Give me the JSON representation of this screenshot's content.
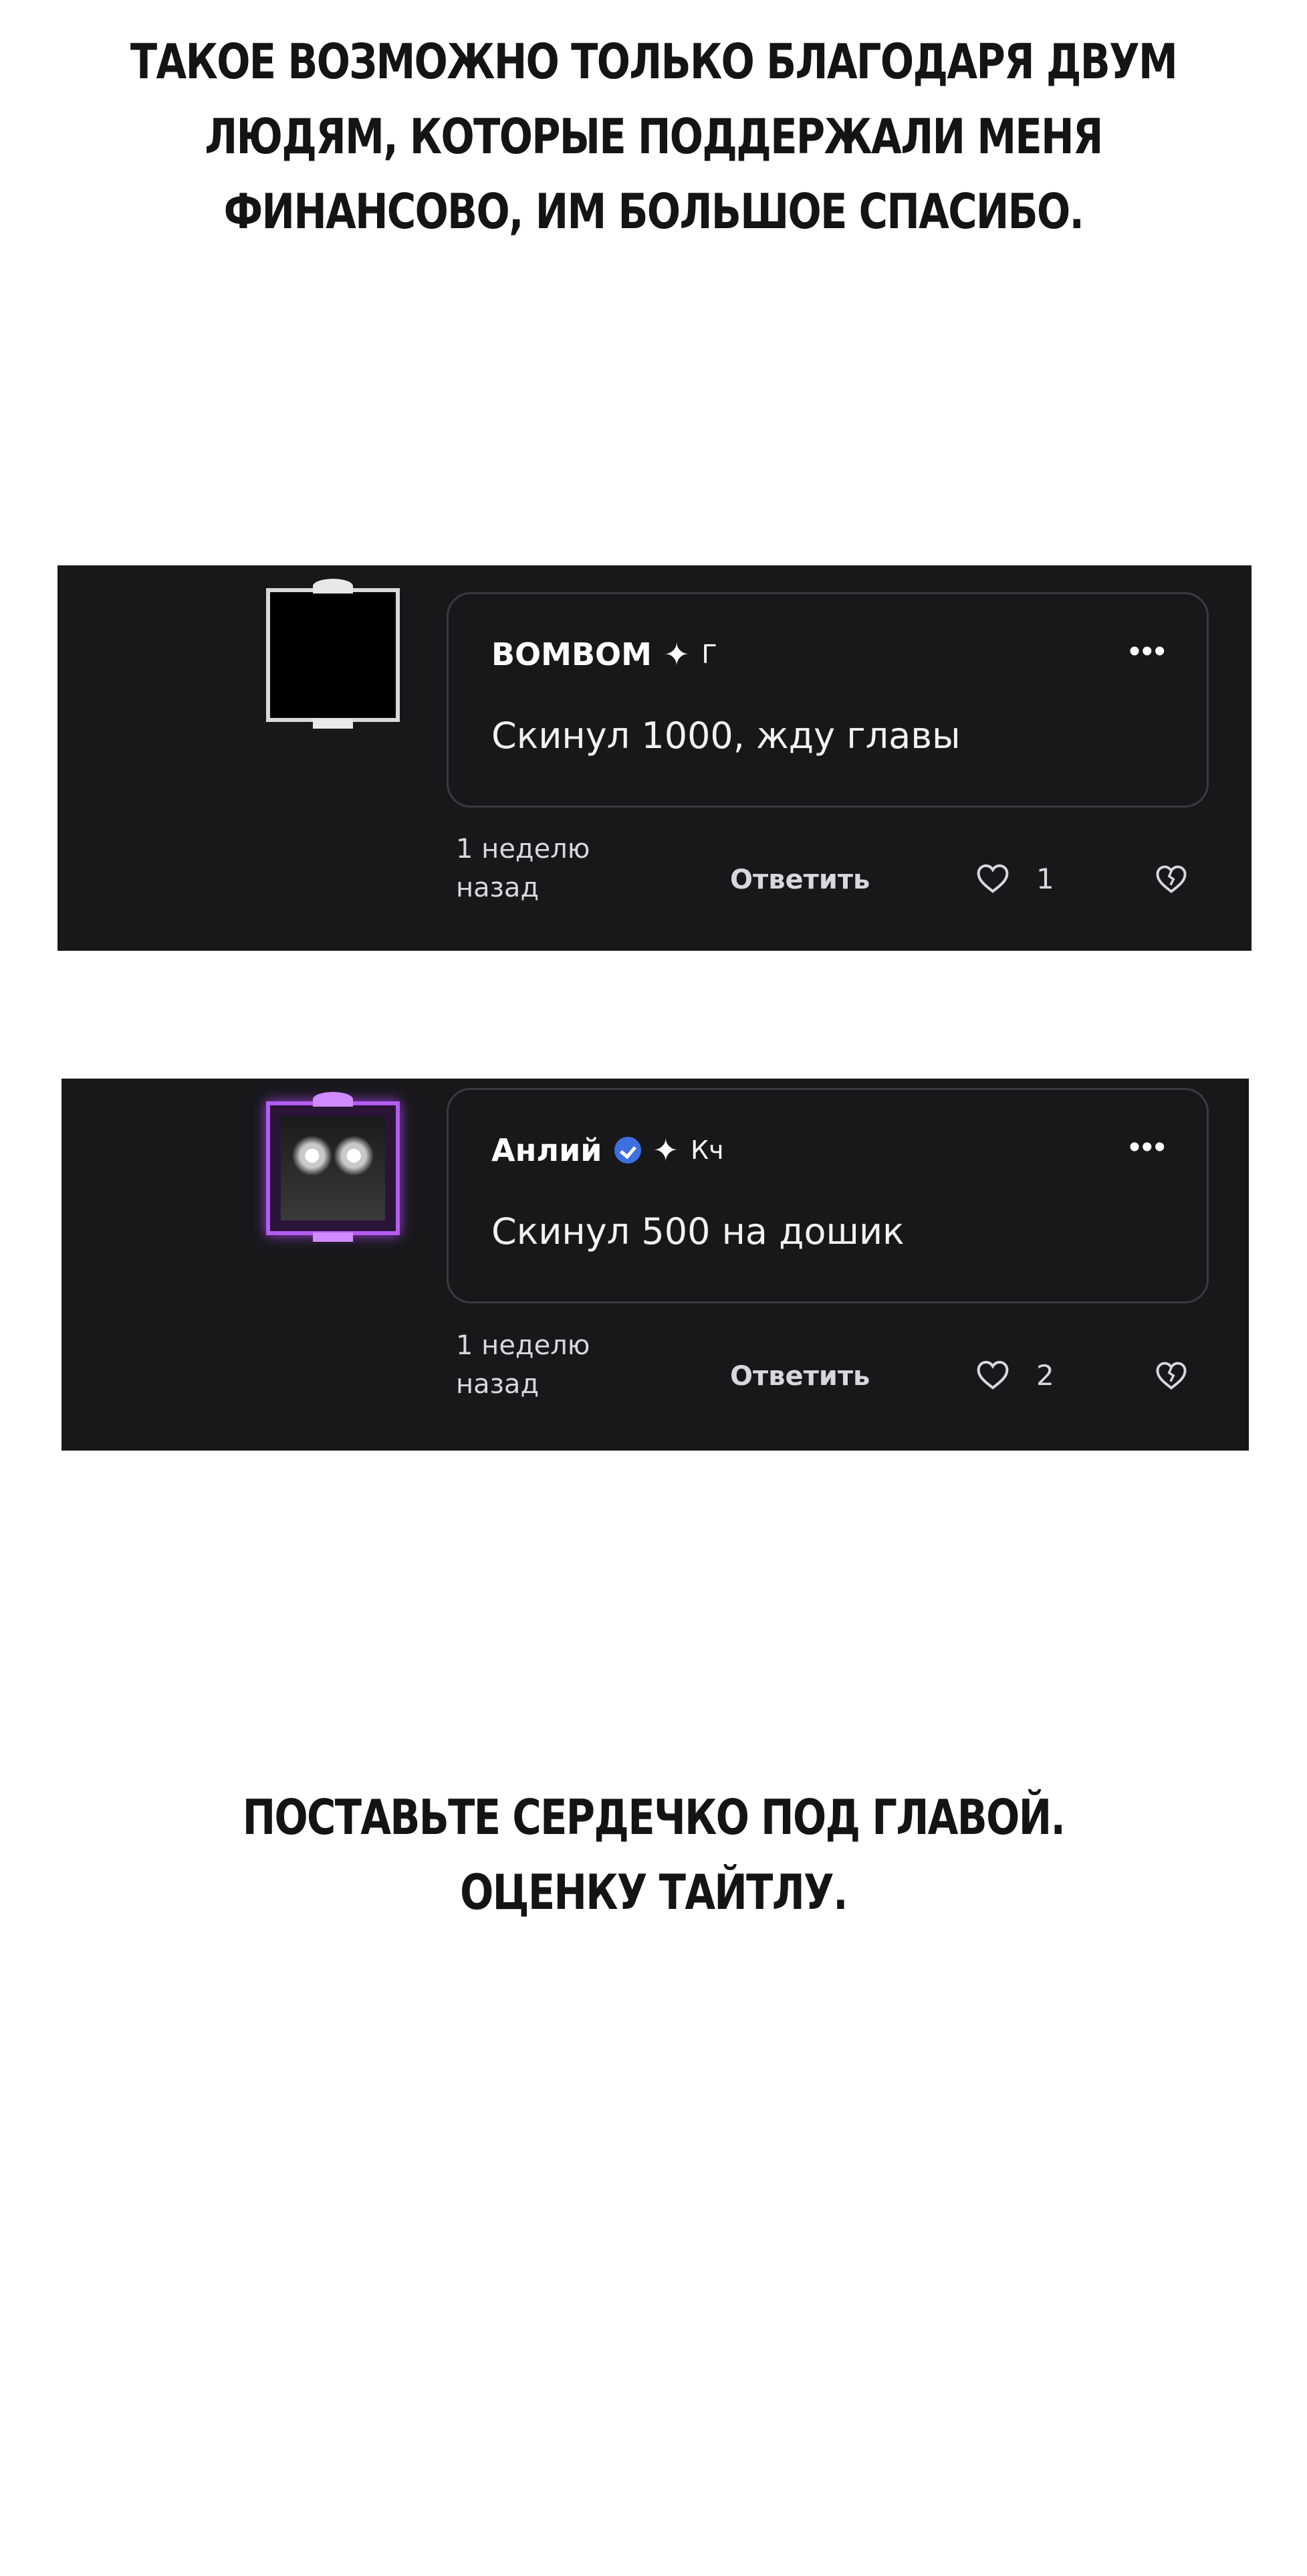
{
  "caption_top": {
    "lines": [
      "ТАКОЕ ВОЗМОЖНО ТОЛЬКО БЛАГОДАРЯ ДВУМ",
      "ЛЮДЯМ, КОТОРЫЕ ПОДДЕРЖАЛИ МЕНЯ",
      "ФИНАНСОВО, ИМ БОЛЬШОЕ СПАСИБО."
    ]
  },
  "comments": [
    {
      "author": "BOMBOM",
      "badge_icon": "sparkle-icon",
      "rank": "Г",
      "text": "Скинул 1000, жду главы",
      "timestamp_line1": "1 неделю",
      "timestamp_line2": "назад",
      "reply_label": "Ответить",
      "likes": "1",
      "avatar_style": "monochrome"
    },
    {
      "author": "Анлий",
      "verified_icon": "verified-icon",
      "badge_icon": "sparkle-icon",
      "rank": "Кч",
      "text": "Скинул 500 на дошик",
      "timestamp_line1": "1 неделю",
      "timestamp_line2": "назад",
      "reply_label": "Ответить",
      "likes": "2",
      "avatar_style": "purple"
    }
  ],
  "caption_bottom": {
    "lines": [
      "ПОСТАВЬТЕ СЕРДЕЧКО ПОД ГЛАВОЙ.",
      "ОЦЕНКУ ТАЙТЛУ."
    ]
  },
  "colors": {
    "panel_bg": "#18181b",
    "bubble_border": "#3a3a3f",
    "verified_blue": "#3d6fe0",
    "avatar_purple": "#b45cf0"
  }
}
